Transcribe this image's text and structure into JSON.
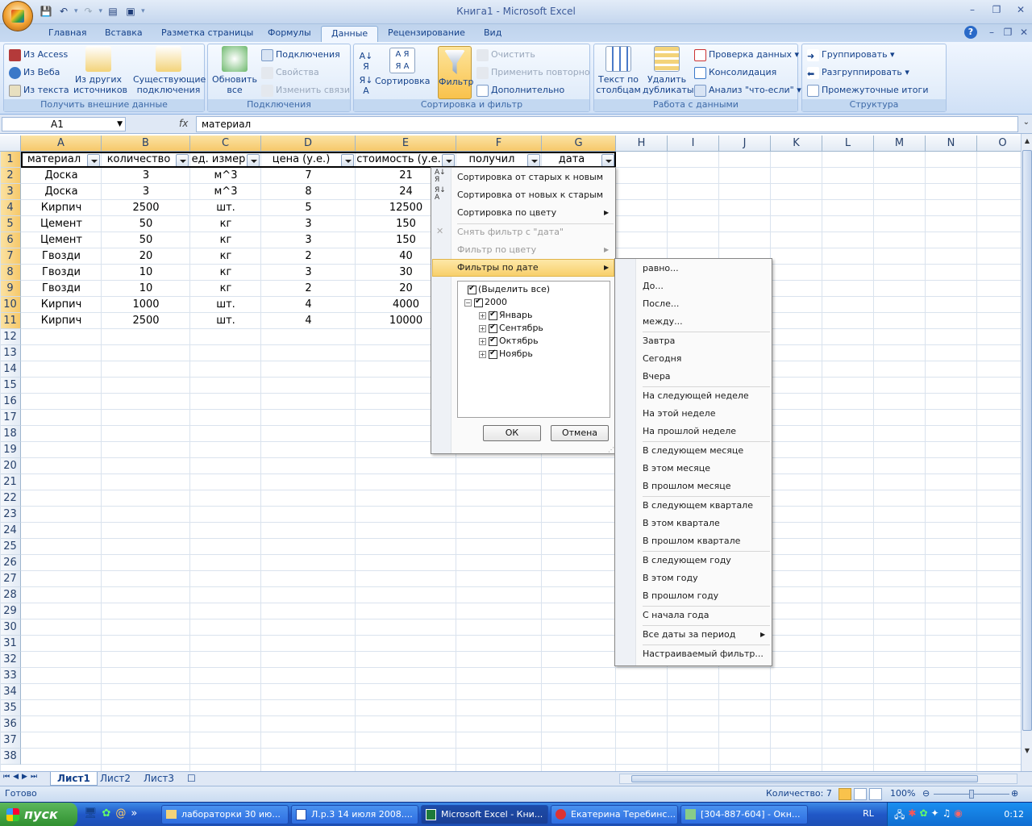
{
  "window": {
    "title": "Книга1 - Microsoft Excel",
    "minimize": "–",
    "restore": "❐",
    "close": "✕"
  },
  "qat": {
    "save": "💾",
    "undo": "↶",
    "redo": "↷",
    "print": "▤",
    "more": "▾"
  },
  "tabs": [
    "Главная",
    "Вставка",
    "Разметка страницы",
    "Формулы",
    "Данные",
    "Рецензирование",
    "Вид"
  ],
  "ribbon": {
    "get_external": {
      "label": "Получить внешние данные",
      "from_access": "Из Access",
      "from_web": "Из Веба",
      "from_text": "Из текста",
      "other_sources": "Из других источников",
      "existing": "Существующие подключения"
    },
    "connections": {
      "label": "Подключения",
      "refresh": "Обновить все",
      "connections": "Подключения",
      "properties": "Свойства",
      "edit_links": "Изменить связи"
    },
    "sort_filter": {
      "label": "Сортировка и фильтр",
      "sort": "Сортировка",
      "filter": "Фильтр",
      "clear": "Очистить",
      "reapply": "Применить повторно",
      "advanced": "Дополнительно"
    },
    "data_tools": {
      "label": "Работа с данными",
      "text_to_cols": "Текст по столбцам",
      "remove_dup": "Удалить дубликаты",
      "validation": "Проверка данных",
      "consolidate": "Консолидация",
      "whatif": "Анализ \"что-если\""
    },
    "outline": {
      "label": "Структура",
      "group": "Группировать",
      "ungroup": "Разгруппировать",
      "subtotal": "Промежуточные итоги"
    }
  },
  "formula": {
    "namebox": "A1",
    "fx": "fx",
    "value": "материал"
  },
  "columns": [
    "A",
    "B",
    "C",
    "D",
    "E",
    "F",
    "G",
    "H",
    "I",
    "J",
    "K",
    "L",
    "M",
    "N",
    "O"
  ],
  "rows": [
    "1",
    "2",
    "3",
    "4",
    "5",
    "6",
    "7",
    "8",
    "9",
    "10",
    "11",
    "12",
    "13",
    "14",
    "15",
    "16",
    "17",
    "18",
    "19",
    "20",
    "21",
    "22",
    "23",
    "24",
    "25",
    "26",
    "27",
    "28",
    "29",
    "30",
    "31",
    "32",
    "33",
    "34",
    "35",
    "36",
    "37",
    "38"
  ],
  "table": {
    "headers": [
      "материал",
      "количество",
      "ед. измер",
      "цена (у.е.)",
      "стоимость (у.е.",
      "получил",
      "дата"
    ],
    "rows": [
      [
        "Доска",
        "3",
        "м^3",
        "7",
        "21"
      ],
      [
        "Доска",
        "3",
        "м^3",
        "8",
        "24"
      ],
      [
        "Кирпич",
        "2500",
        "шт.",
        "5",
        "12500"
      ],
      [
        "Цемент",
        "50",
        "кг",
        "3",
        "150"
      ],
      [
        "Цемент",
        "50",
        "кг",
        "3",
        "150"
      ],
      [
        "Гвозди",
        "20",
        "кг",
        "2",
        "40"
      ],
      [
        "Гвозди",
        "10",
        "кг",
        "3",
        "30"
      ],
      [
        "Гвозди",
        "10",
        "кг",
        "2",
        "20"
      ],
      [
        "Кирпич",
        "1000",
        "шт.",
        "4",
        "4000"
      ],
      [
        "Кирпич",
        "2500",
        "шт.",
        "4",
        "10000"
      ]
    ]
  },
  "filter_menu": {
    "sort_old_new": "Сортировка от старых к новым",
    "sort_new_old": "Сортировка от новых к старым",
    "sort_color": "Сортировка по цвету",
    "clear_filter": "Снять фильтр с \"дата\"",
    "filter_color": "Фильтр по цвету",
    "date_filters": "Фильтры по дате",
    "tree": {
      "select_all": "(Выделить все)",
      "year": "2000",
      "months": [
        "Январь",
        "Сентябрь",
        "Октябрь",
        "Ноябрь"
      ]
    },
    "ok": "ОК",
    "cancel": "Отмена"
  },
  "date_submenu": [
    "равно...",
    "До...",
    "После...",
    "между...",
    "Завтра",
    "Сегодня",
    "Вчера",
    "На следующей неделе",
    "На этой неделе",
    "На прошлой неделе",
    "В следующем месяце",
    "В этом месяце",
    "В прошлом месяце",
    "В следующем квартале",
    "В этом квартале",
    "В прошлом квартале",
    "В следующем году",
    "В этом году",
    "В прошлом году",
    "С начала года",
    "Все даты за период",
    "Настраиваемый фильтр..."
  ],
  "sheets": [
    "Лист1",
    "Лист2",
    "Лист3"
  ],
  "status": {
    "ready": "Готово",
    "count": "Количество: 7",
    "zoom": "100%"
  },
  "taskbar": {
    "start": "пуск",
    "tasks": [
      "лабораторки 30 ию...",
      "Л.р.3 14 июля 2008....",
      "Microsoft Excel - Кни...",
      "Екатерина Теребинс...",
      "[304-887-604] - Окн..."
    ],
    "lang": "RL",
    "clock": "0:12"
  },
  "colors": {
    "ribbon": "#dde9f9",
    "selected": "#f9c24c",
    "taskbar": "#2158c8"
  }
}
